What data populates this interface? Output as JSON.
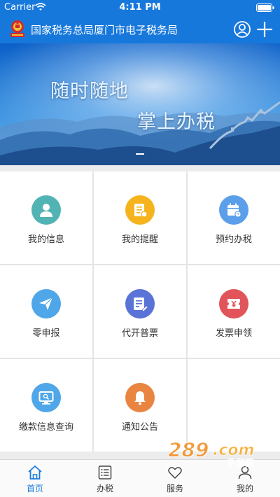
{
  "status_bar": {
    "carrier": "Carrier",
    "time": "4:11 PM"
  },
  "header": {
    "title": "国家税务总局厦门市电子税务局"
  },
  "banner": {
    "line1": "随时随地",
    "line2": "掌上办税"
  },
  "grid": {
    "items": [
      {
        "label": "我的信息",
        "icon": "user-icon",
        "color": "#52b3b5"
      },
      {
        "label": "我的提醒",
        "icon": "reminder-icon",
        "color": "#f5b41e"
      },
      {
        "label": "预约办税",
        "icon": "calendar-icon",
        "color": "#5b9eea"
      },
      {
        "label": "零申报",
        "icon": "paper-plane-icon",
        "color": "#4fa6e8"
      },
      {
        "label": "代开普票",
        "icon": "invoice-icon",
        "color": "#5a73d6"
      },
      {
        "label": "发票申领",
        "icon": "ticket-icon",
        "color": "#e0545a"
      },
      {
        "label": "缴款信息查询",
        "icon": "monitor-icon",
        "color": "#4fa6e8"
      },
      {
        "label": "通知公告",
        "icon": "bell-icon",
        "color": "#e98441"
      }
    ]
  },
  "tabbar": {
    "tabs": [
      {
        "label": "首页",
        "icon": "home-icon",
        "active": true
      },
      {
        "label": "办税",
        "icon": "list-icon",
        "active": false
      },
      {
        "label": "服务",
        "icon": "heart-icon",
        "active": false
      },
      {
        "label": "我的",
        "icon": "person-icon",
        "active": false
      }
    ],
    "active_color": "#1a7cdc"
  },
  "watermark": {
    "text": "289.com",
    "subtext": "手游网"
  },
  "colors": {
    "header": "#1778dc",
    "page_bg": "#ececec"
  }
}
